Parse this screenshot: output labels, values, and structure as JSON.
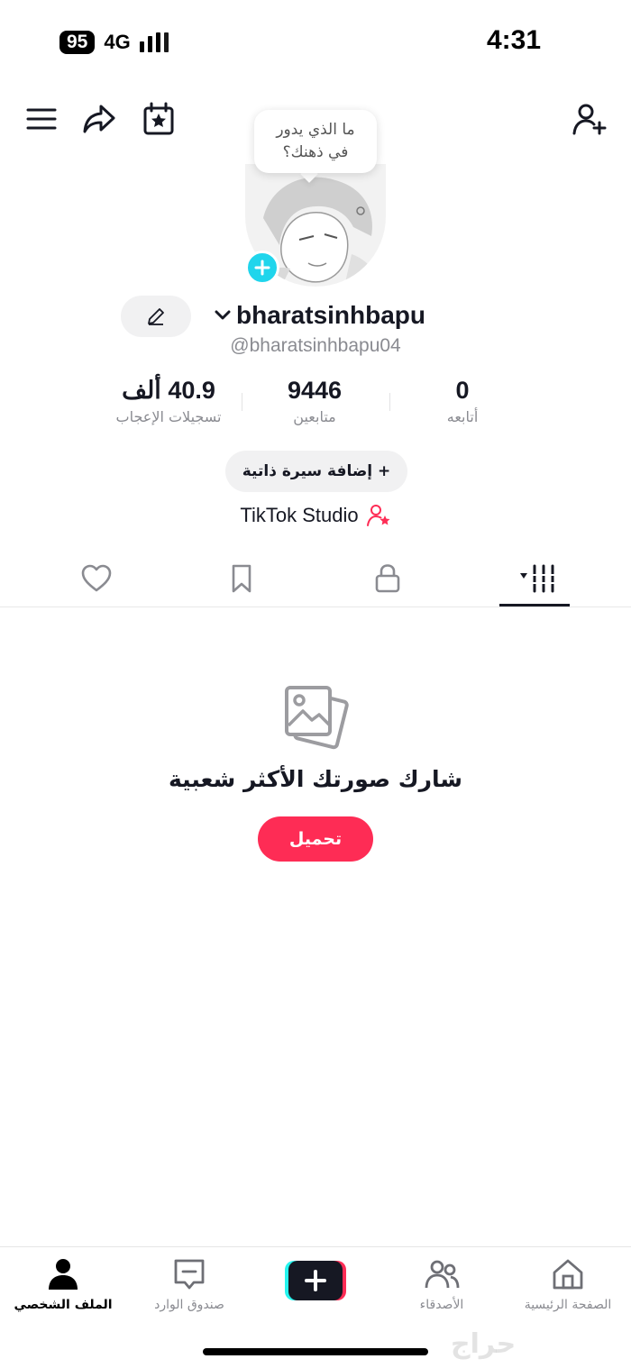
{
  "status_bar": {
    "battery": "95",
    "network": "4G",
    "time": "4:31"
  },
  "top_bar": {
    "icons": [
      "menu-icon",
      "share-icon",
      "calendar-star-icon",
      "add-friend-icon"
    ]
  },
  "profile": {
    "bubble_text": "ما الذي يدور في ذهنك؟",
    "username": "bharatsinhbapu",
    "handle": "@bharatsinhbapu04"
  },
  "stats": {
    "likes_value": "40.9 ألف",
    "likes_label": "تسجيلات الإعجاب",
    "followers_value": "9446",
    "followers_label": "متابعين",
    "following_value": "0",
    "following_label": "أتابعه"
  },
  "bio_button": "+ إضافة سيرة ذاتية",
  "studio_link": "TikTok Studio",
  "tabs": [
    "liked-icon",
    "bookmark-icon",
    "lock-icon",
    "grid-icon"
  ],
  "empty_state": {
    "title": "شارك صورتك الأكثر شعبية",
    "button": "تحميل"
  },
  "bottom_nav": {
    "home": "الصفحة الرئيسية",
    "friends": "الأصدقاء",
    "inbox": "صندوق الوارد",
    "profile": "الملف الشخصي"
  },
  "watermark": "حراج",
  "colors": {
    "accent": "#fe2c55",
    "cyan": "#20d5ec",
    "text": "#161823",
    "muted": "#8a8b91"
  }
}
